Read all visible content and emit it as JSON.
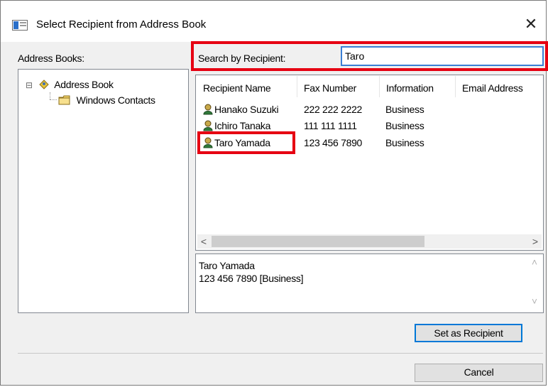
{
  "window": {
    "title": "Select Recipient from Address Book",
    "close_glyph": "✕"
  },
  "address_books": {
    "label": "Address Books:",
    "tree": [
      {
        "expander": "⊟",
        "label": "Address Book",
        "icon": "address-book-icon"
      },
      {
        "label": "Windows Contacts",
        "icon": "folder-icon"
      }
    ]
  },
  "search": {
    "label": "Search by Recipient:",
    "value": "Taro"
  },
  "recipients": {
    "columns": [
      "Recipient Name",
      "Fax Number",
      "Information",
      "Email Address"
    ],
    "rows": [
      {
        "name": "Hanako Suzuki",
        "fax": "222 222 2222",
        "info": "Business",
        "email": ""
      },
      {
        "name": "Ichiro Tanaka",
        "fax": "111 111 1111",
        "info": "Business",
        "email": ""
      },
      {
        "name": "Taro Yamada",
        "fax": "123 456 7890",
        "info": "Business",
        "email": ""
      }
    ],
    "scroll_left": "<",
    "scroll_right": ">"
  },
  "details": {
    "line1": "Taro Yamada",
    "line2": "123 456 7890 [Business]",
    "up": "˄",
    "down": "˅"
  },
  "buttons": {
    "set_as_recipient": "Set as Recipient",
    "cancel": "Cancel"
  },
  "colors": {
    "highlight": "#e60012",
    "focus": "#0078d7",
    "background": "#f0f0f0"
  }
}
